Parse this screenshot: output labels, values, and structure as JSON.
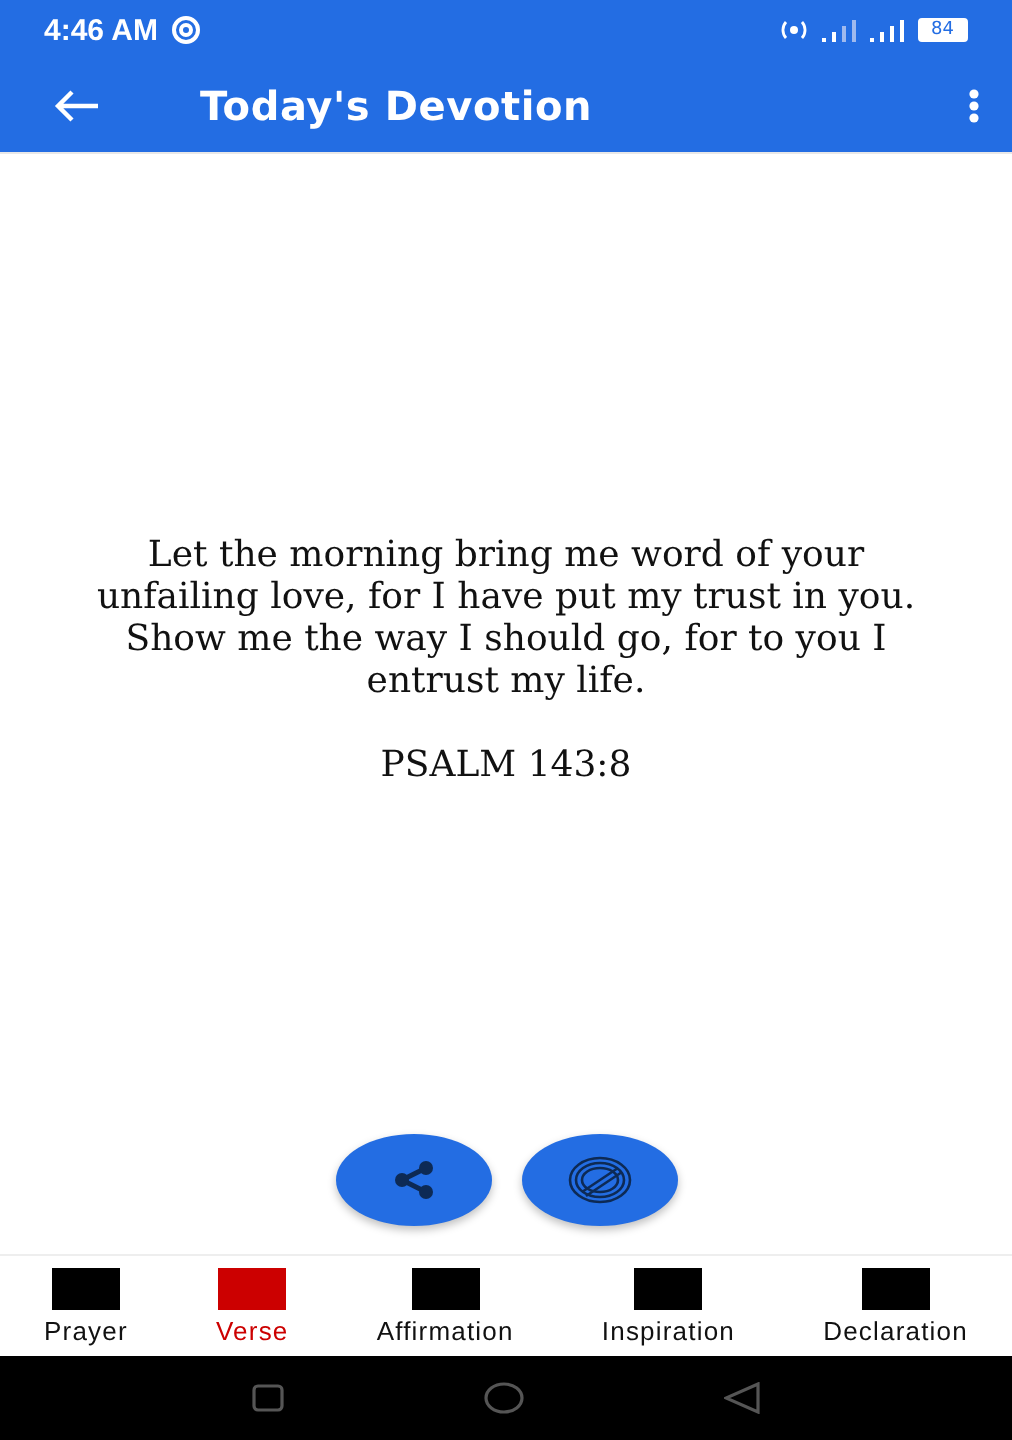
{
  "status_bar": {
    "time": "4:46 AM",
    "battery": "84"
  },
  "app_bar": {
    "title": "Today's Devotion"
  },
  "devotion": {
    "text": "Let the morning bring me word of your unfailing love, for I have put my trust in you. Show me the way I should go, for to you I entrust my life.",
    "reference": "PSALM 143:8"
  },
  "tabs": [
    {
      "label": "Prayer",
      "selected": false
    },
    {
      "label": "Verse",
      "selected": true
    },
    {
      "label": "Affirmation",
      "selected": false
    },
    {
      "label": "Inspiration",
      "selected": false
    },
    {
      "label": "Declaration",
      "selected": false
    }
  ]
}
